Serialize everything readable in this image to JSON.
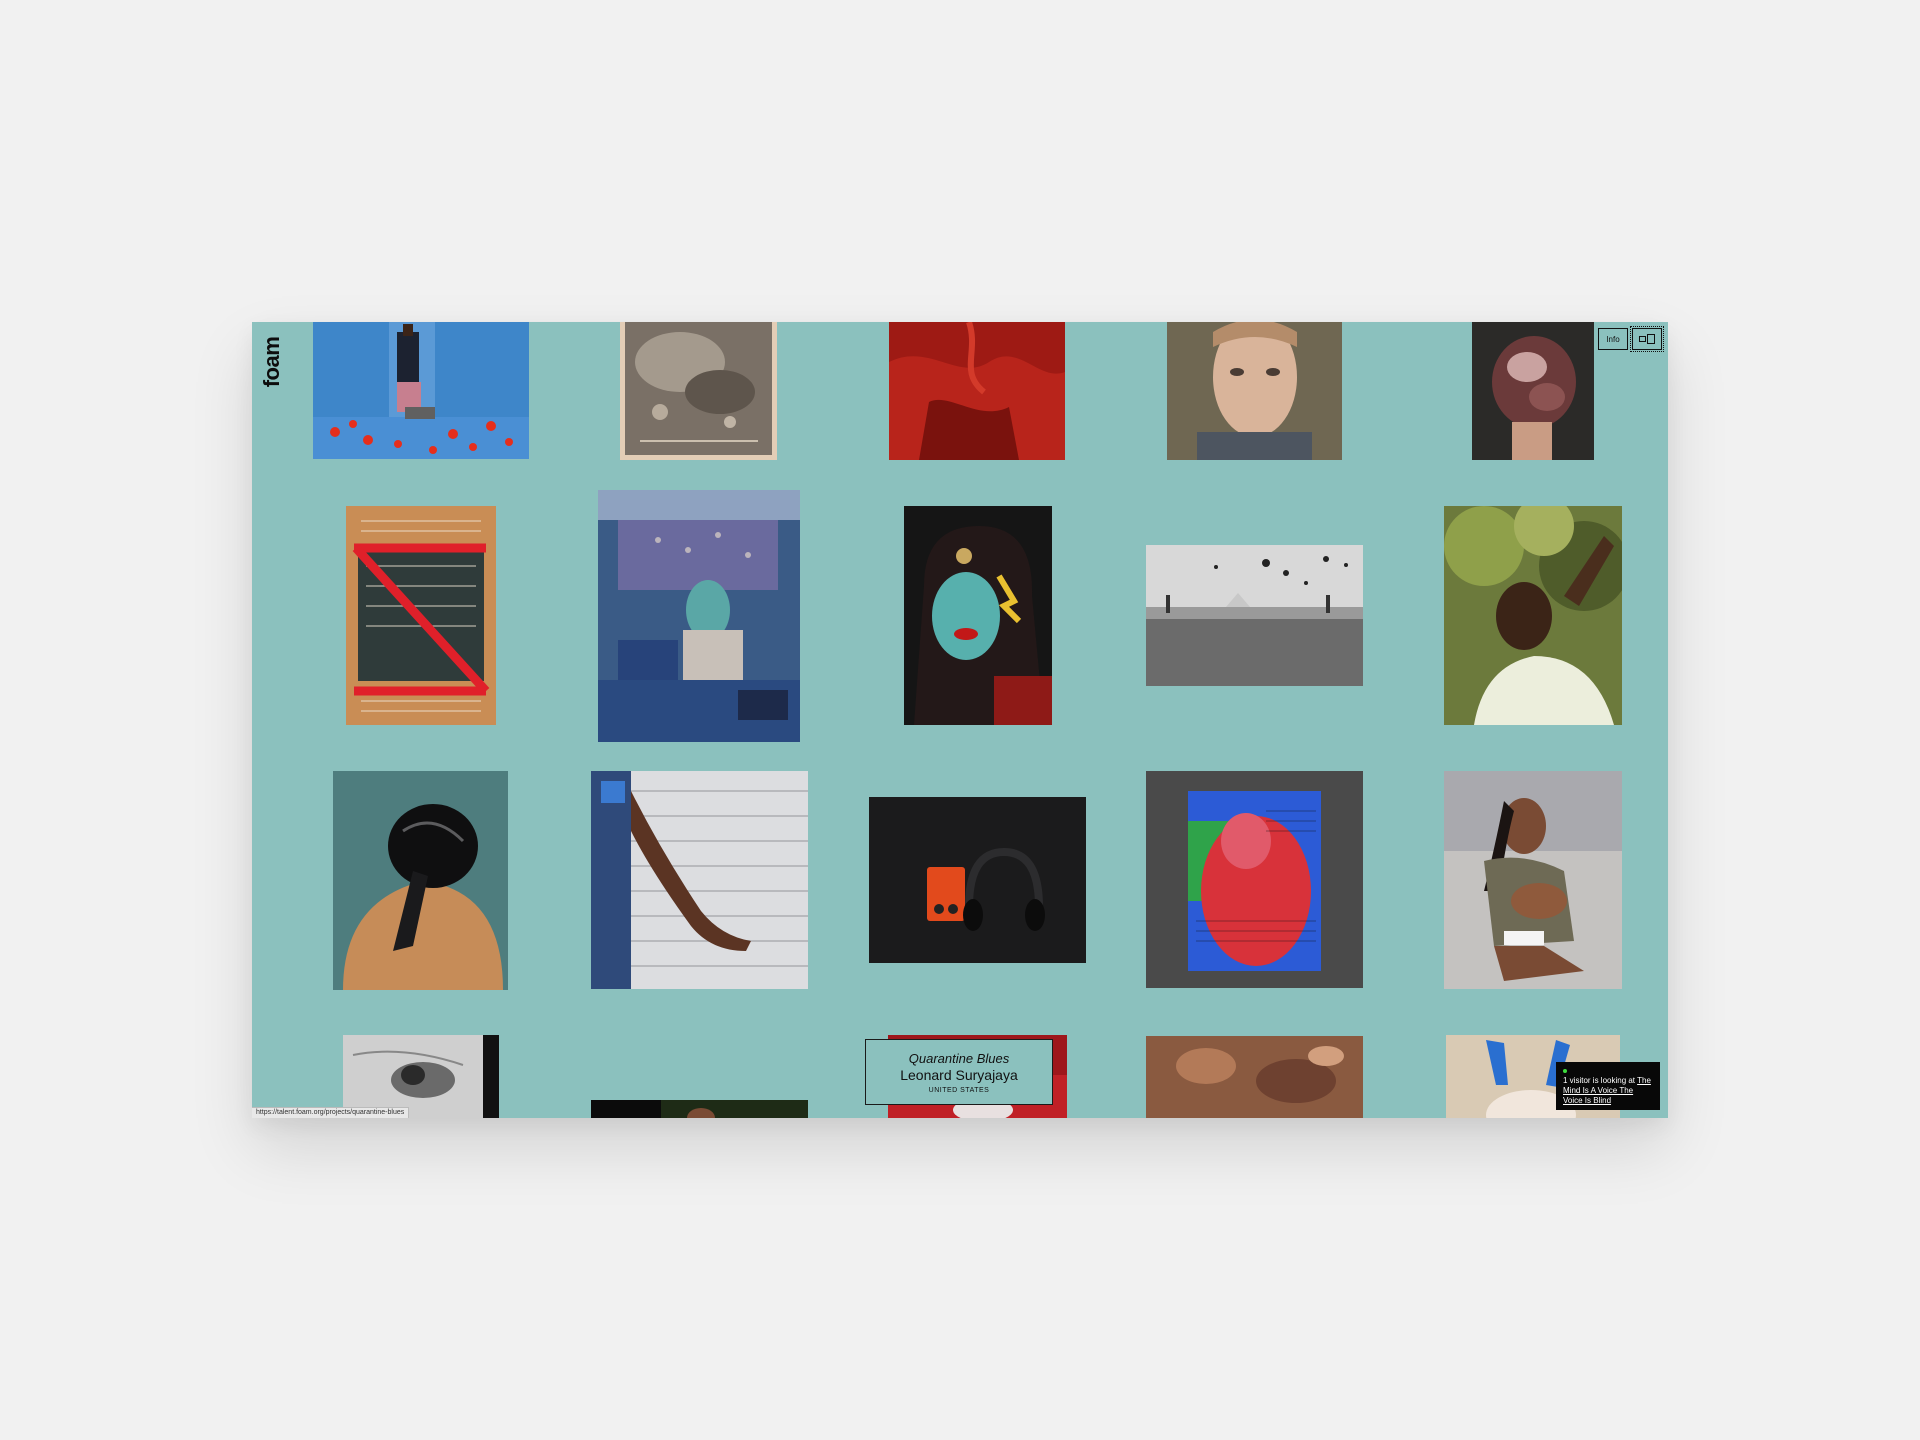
{
  "brand": {
    "logo_text": "foam"
  },
  "controls": {
    "info_label": "Info",
    "view_icon": "split-view-icon"
  },
  "grid": {
    "tiles": [
      {
        "name": "photo-man-suit-tomatoes",
        "row": 1,
        "col": 1
      },
      {
        "name": "photo-sepia-print",
        "row": 1,
        "col": 2
      },
      {
        "name": "photo-red-drapery",
        "row": 1,
        "col": 3
      },
      {
        "name": "photo-portrait-young-man",
        "row": 1,
        "col": 4
      },
      {
        "name": "photo-crumpled-paper-hand",
        "row": 1,
        "col": 5
      },
      {
        "name": "photo-chalkboard-red-tape",
        "row": 2,
        "col": 1
      },
      {
        "name": "photo-blue-room-mask",
        "row": 2,
        "col": 2
      },
      {
        "name": "photo-teal-face-woman",
        "row": 2,
        "col": 3
      },
      {
        "name": "photo-bw-landscape-birds",
        "row": 2,
        "col": 4
      },
      {
        "name": "photo-man-trees-hand",
        "row": 2,
        "col": 5
      },
      {
        "name": "photo-durag-back",
        "row": 3,
        "col": 1
      },
      {
        "name": "photo-arm-shutter",
        "row": 3,
        "col": 2
      },
      {
        "name": "photo-orange-device-headphones",
        "row": 3,
        "col": 3
      },
      {
        "name": "photo-glitch-red-figure",
        "row": 3,
        "col": 4
      },
      {
        "name": "photo-woman-child-sofa",
        "row": 3,
        "col": 5
      },
      {
        "name": "photo-bw-man-lying",
        "row": 4,
        "col": 1
      },
      {
        "name": "photo-dark-foliage",
        "row": 4,
        "col": 2
      },
      {
        "name": "photo-red-quarantine",
        "row": 4,
        "col": 3
      },
      {
        "name": "photo-brown-texture",
        "row": 4,
        "col": 4
      },
      {
        "name": "photo-bunny-ears",
        "row": 4,
        "col": 5
      }
    ]
  },
  "hover_card": {
    "title": "Quarantine Blues",
    "artist": "Leonard Suryajaya",
    "country": "UNITED STATES"
  },
  "status_bar": {
    "url": "https://talent.foam.org/projects/quarantine-blues"
  },
  "visitor_notice": {
    "prefix": "1 visitor is looking at ",
    "link": "The Mind Is A Voice The Voice Is Blind"
  },
  "colors": {
    "background": "#8bc1be",
    "page": "#f1f1f1",
    "text": "#111111"
  }
}
